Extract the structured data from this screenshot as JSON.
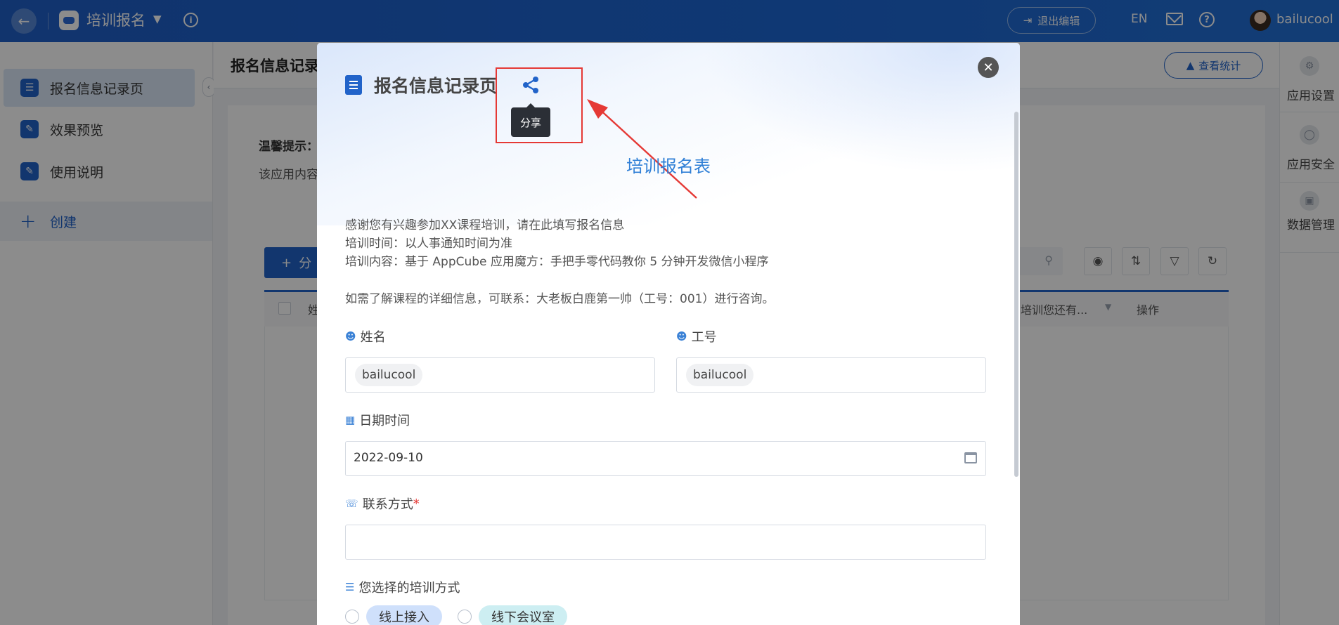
{
  "topbar": {
    "app_title": "培训报名",
    "exit_edit": "退出编辑",
    "lang": "EN",
    "username": "bailucool"
  },
  "sidebar": {
    "items": [
      {
        "label": "报名信息记录页",
        "icon": "form-icon"
      },
      {
        "label": "效果预览",
        "icon": "edit-icon"
      },
      {
        "label": "使用说明",
        "icon": "edit-icon"
      }
    ],
    "create": "创建"
  },
  "main": {
    "title": "报名信息记录",
    "stats_button": "查看统计",
    "tip_title": "温馨提示：",
    "tip_text": "该应用内容",
    "add_button": "分",
    "grid": {
      "col_name": "姓",
      "col_question": "培训您还有...",
      "col_action": "操作"
    }
  },
  "rail": {
    "items": [
      {
        "label": "应用设置",
        "icon": "gear-icon"
      },
      {
        "label": "应用安全",
        "icon": "shield-icon"
      },
      {
        "label": "数据管理",
        "icon": "monitor-icon"
      }
    ]
  },
  "modal": {
    "title": "报名信息记录页",
    "tooltip": "分享",
    "form_title": "培训报名表",
    "desc": [
      "感谢您有兴趣参加XX课程培训，请在此填写报名信息",
      "培训时间：以人事通知时间为准",
      "培训内容：基于 AppCube 应用魔方：手把手零代码教你 5 分钟开发微信小程序",
      "如需了解课程的详细信息，可联系：大老板白鹿第一帅（工号：001）进行咨询。"
    ],
    "fields": {
      "name_label": "姓名",
      "name_value": "bailucool",
      "id_label": "工号",
      "id_value": "bailucool",
      "date_label": "日期时间",
      "date_value": "2022-09-10",
      "contact_label": "联系方式",
      "contact_required": "*",
      "contact_value": "",
      "method_label": "您选择的培训方式",
      "method_options": [
        "线上接入",
        "线下会议室"
      ]
    },
    "colors": {
      "accent": "#2163c9",
      "highlight": "#e53935",
      "tag_blue": "#cfe0fb",
      "tag_cyan": "#cdeef2"
    }
  }
}
